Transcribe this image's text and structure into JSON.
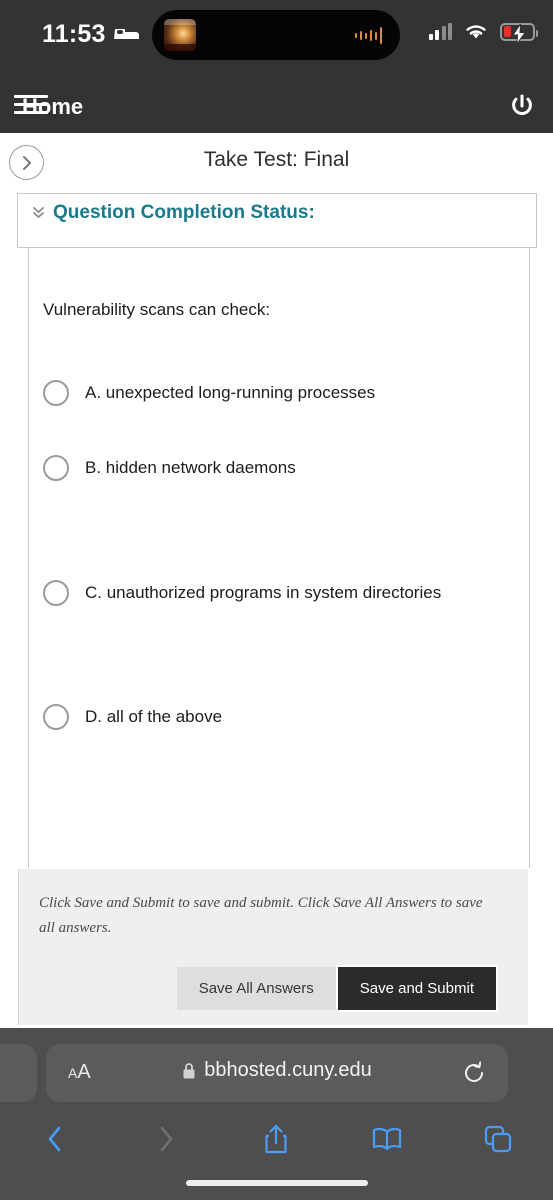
{
  "status_bar": {
    "time": "11:53",
    "sleep_icon": "bed-icon",
    "cell_icon": "cellular-signal-icon",
    "wifi_icon": "wifi-icon",
    "battery_icon": "battery-charging-icon",
    "dynamic_island": {
      "album_art": "now-playing-album-art",
      "waveform": "audio-waveform-icon"
    }
  },
  "app_header": {
    "menu_icon": "hamburger-menu-icon",
    "title": "Home",
    "power_icon": "power-icon"
  },
  "title_bar": {
    "back_icon": "chevron-right-icon",
    "title": "Take Test: Final"
  },
  "question_completion": {
    "expand_icon": "double-chevron-down-icon",
    "label": "Question Completion Status:"
  },
  "question": {
    "prompt": "Vulnerability scans can check:",
    "options": [
      {
        "label": "A. unexpected long-running processes",
        "selected": false
      },
      {
        "label": "B. hidden network daemons",
        "selected": false
      },
      {
        "label": "C. unauthorized programs in system directories",
        "selected": false
      },
      {
        "label": "D. all of the above",
        "selected": false
      }
    ]
  },
  "footer": {
    "note": "Click Save and Submit to save and submit. Click Save All Answers to save all answers.",
    "save_all_label": "Save All Answers",
    "save_submit_label": "Save and Submit"
  },
  "safari": {
    "text_size_small": "A",
    "text_size_big": "A",
    "lock_icon": "lock-icon",
    "url": "bbhosted.cuny.edu",
    "reload_icon": "reload-icon",
    "toolbar": {
      "back_icon": "back-chevron-icon",
      "forward_icon": "forward-chevron-icon",
      "share_icon": "share-icon",
      "bookmarks_icon": "book-icon",
      "tabs_icon": "tabs-icon"
    }
  },
  "colors": {
    "header_bg": "#333333",
    "accent_teal": "#1a7a8c",
    "safari_chrome": "#4e4e4e",
    "safari_blue": "#4a9cf6",
    "submit_btn": "#2b2b2b"
  }
}
